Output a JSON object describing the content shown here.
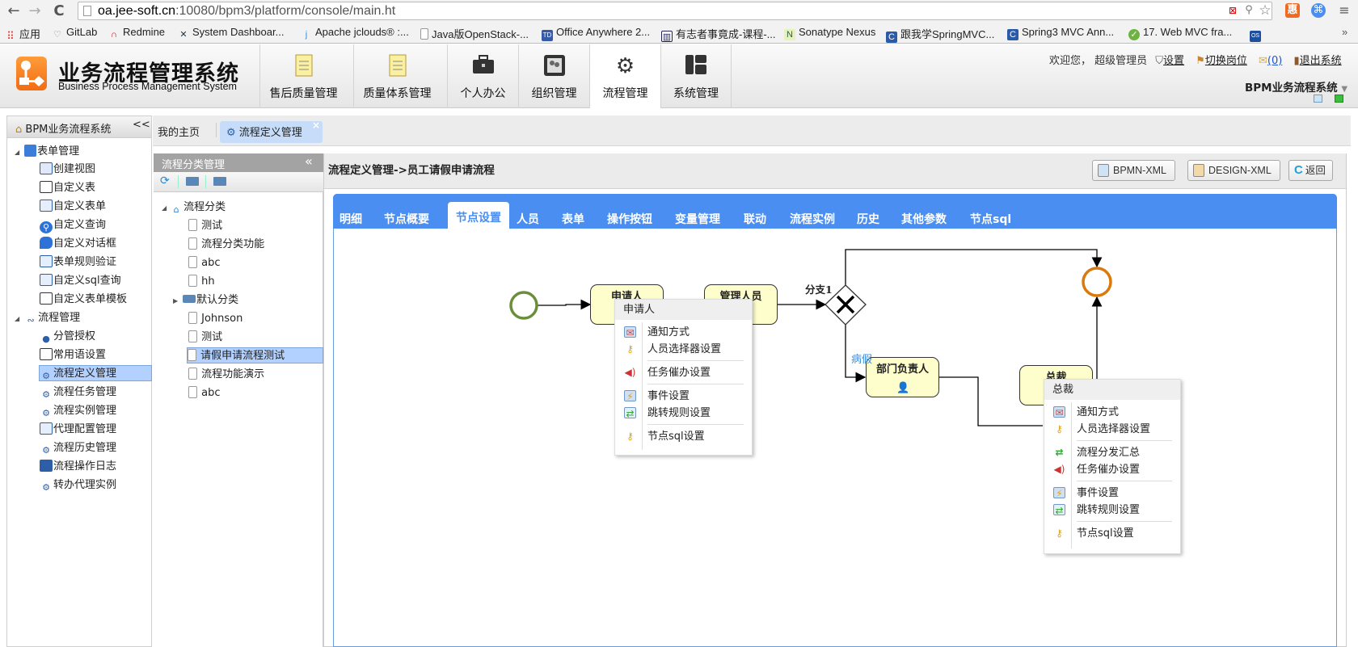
{
  "browser": {
    "url_host": "oa.jee-soft.cn",
    "url_rest": ":10080/bpm3/platform/console/main.ht",
    "bookmarks": [
      {
        "label": "应用",
        "icon": "apps-grid-icon"
      },
      {
        "label": "GitLab",
        "icon": "gitlab-icon"
      },
      {
        "label": "Redmine",
        "icon": "redmine-icon"
      },
      {
        "label": "System Dashboar...",
        "icon": "jira-icon"
      },
      {
        "label": "Apache jclouds® :...",
        "icon": "jclouds-icon"
      },
      {
        "label": "Java版OpenStack-...",
        "icon": "page-icon"
      },
      {
        "label": "Office Anywhere 2...",
        "icon": "td-icon"
      },
      {
        "label": "有志者事竟成-课程-...",
        "icon": "chart-icon"
      },
      {
        "label": "Sonatype Nexus",
        "icon": "nexus-icon"
      },
      {
        "label": "跟我学SpringMVC...",
        "icon": "blog-icon"
      },
      {
        "label": "Spring3 MVC Ann...",
        "icon": "blog-icon"
      },
      {
        "label": "17. Web MVC fra...",
        "icon": "spring-icon"
      },
      {
        "label": "",
        "icon": "os4j-icon"
      }
    ],
    "more": "»"
  },
  "header": {
    "title": "业务流程管理系统",
    "subtitle": "Business Process Management System",
    "nav": [
      {
        "label": "售后质量管理",
        "icon": "document-icon"
      },
      {
        "label": "质量体系管理",
        "icon": "document-icon"
      },
      {
        "label": "个人办公",
        "icon": "briefcase-icon"
      },
      {
        "label": "组织管理",
        "icon": "org-icon"
      },
      {
        "label": "流程管理",
        "icon": "gears-icon",
        "active": true
      },
      {
        "label": "系统管理",
        "icon": "layout-icon"
      }
    ],
    "welcome": "欢迎您， 超级管理员",
    "settings": "设置",
    "switch_post": "切换岗位",
    "mail_count": "(0)",
    "logout": "退出系统",
    "system_name": "BPM业务流程系统"
  },
  "sidebar": {
    "title": "BPM业务流程系统",
    "collapse": "<<",
    "groups": [
      {
        "label": "表单管理",
        "items": [
          "创建视图",
          "自定义表",
          "自定义表单",
          "自定义查询",
          "自定义对话框",
          "表单规则验证",
          "自定义sql查询",
          "自定义表单模板"
        ]
      },
      {
        "label": "流程管理",
        "items": [
          "分管授权",
          "常用语设置",
          "流程定义管理",
          "流程任务管理",
          "流程实例管理",
          "代理配置管理",
          "流程历史管理",
          "流程操作日志",
          "转办代理实例"
        ]
      }
    ],
    "selected": "流程定义管理"
  },
  "tabs": {
    "home": "我的主页",
    "active": "流程定义管理",
    "close": "×"
  },
  "category": {
    "title": "流程分类管理",
    "collapse": "«",
    "root": "流程分类",
    "items": [
      {
        "label": "测试",
        "type": "file"
      },
      {
        "label": "流程分类功能",
        "type": "file"
      },
      {
        "label": "abc",
        "type": "file"
      },
      {
        "label": "hh",
        "type": "file"
      },
      {
        "label": "默认分类",
        "type": "folder"
      },
      {
        "label": "Johnson",
        "type": "file"
      },
      {
        "label": "测试",
        "type": "file"
      },
      {
        "label": "请假申请流程测试",
        "type": "file",
        "selected": true
      },
      {
        "label": "流程功能演示",
        "type": "file"
      },
      {
        "label": "abc",
        "type": "file"
      }
    ]
  },
  "main": {
    "breadcrumb": "流程定义管理->员工请假申请流程",
    "buttons": {
      "bpmn": "BPMN-XML",
      "design": "DESIGN-XML",
      "back": "返回"
    },
    "tabs": [
      "明细",
      "节点概要",
      "节点设置",
      "人员",
      "表单",
      "操作按钮",
      "变量管理",
      "联动",
      "流程实例",
      "历史",
      "其他参数",
      "节点sql"
    ],
    "active_tab": "节点设置"
  },
  "diagram": {
    "tasks": {
      "applicant": "申请人",
      "manager": "管理人员",
      "dept_head": "部门负责人",
      "ceo": "总裁"
    },
    "gateway": "分支1",
    "condition": "病假",
    "colors": {
      "start": "#6b8e3a",
      "end": "#d97a0e",
      "task_fill": "#fefecd",
      "tab_blue": "#4a8ef2"
    }
  },
  "menu1": {
    "title": "申请人",
    "items": [
      "通知方式",
      "人员选择器设置",
      "任务催办设置",
      "事件设置",
      "跳转规则设置",
      "节点sql设置"
    ]
  },
  "menu2": {
    "title": "总裁",
    "items": [
      "通知方式",
      "人员选择器设置",
      "流程分发汇总",
      "任务催办设置",
      "事件设置",
      "跳转规则设置",
      "节点sql设置"
    ]
  }
}
